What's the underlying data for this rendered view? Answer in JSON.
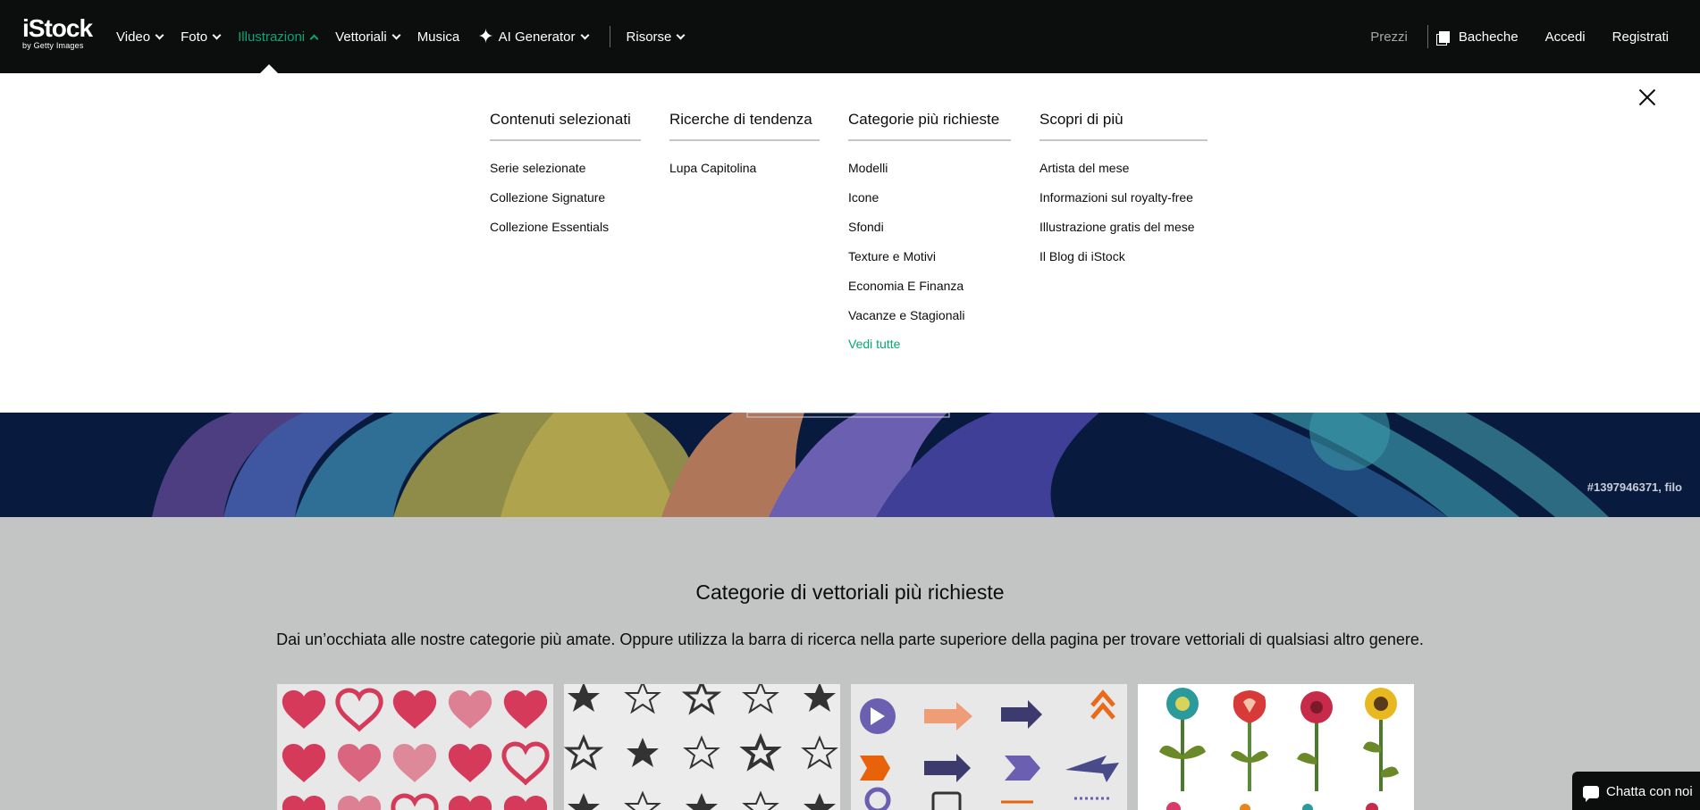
{
  "brand": {
    "name": "iStock",
    "tagline": "by Getty Images"
  },
  "nav": {
    "left": [
      {
        "label": "Video",
        "dropdown": true
      },
      {
        "label": "Foto",
        "dropdown": true
      },
      {
        "label": "Illustrazioni",
        "dropdown": true,
        "active": true
      },
      {
        "label": "Vettoriali",
        "dropdown": true
      },
      {
        "label": "Musica",
        "dropdown": false
      },
      {
        "label": "AI Generator",
        "dropdown": true,
        "icon": "sparkle-icon"
      },
      {
        "label": "Risorse",
        "dropdown": true
      }
    ],
    "right": {
      "prezzi": "Prezzi",
      "bacheche": "Bacheche",
      "accedi": "Accedi",
      "registrati": "Registrati"
    }
  },
  "menu": {
    "columns": [
      {
        "title": "Contenuti selezionati",
        "items": [
          "Serie selezionate",
          "Collezione Signature",
          "Collezione Essentials"
        ]
      },
      {
        "title": "Ricerche di tendenza",
        "items": [
          "Lupa Capitolina"
        ]
      },
      {
        "title": "Categorie più richieste",
        "items": [
          "Modelli",
          "Icone",
          "Sfondi",
          "Texture e Motivi",
          "Economia E Finanza",
          "Vacanze e Stagionali"
        ],
        "see_all": "Vedi tutte"
      },
      {
        "title": "Scopri di più",
        "items": [
          "Artista del mese",
          "Informazioni sul royalty-free",
          "Illustrazione gratis del mese",
          "Il Blog di iStock"
        ]
      }
    ]
  },
  "hero": {
    "credit": "#1397946371, filo"
  },
  "section": {
    "title": "Categorie di vettoriali più richieste",
    "subtitle": "Dai un’occhiata alle nostre categorie più amate. Oppure utilizza la barra di ricerca nella parte superiore della pagina per trovare vettoriali di qualsiasi altro genere.",
    "tiles": [
      "hearts",
      "stars",
      "arrows",
      "flowers"
    ]
  },
  "chat": {
    "label": "Chatta con noi"
  },
  "colors": {
    "accent": "#08a576",
    "nav_bg": "#0c0d0d",
    "section_bg": "#c3c4c4"
  }
}
